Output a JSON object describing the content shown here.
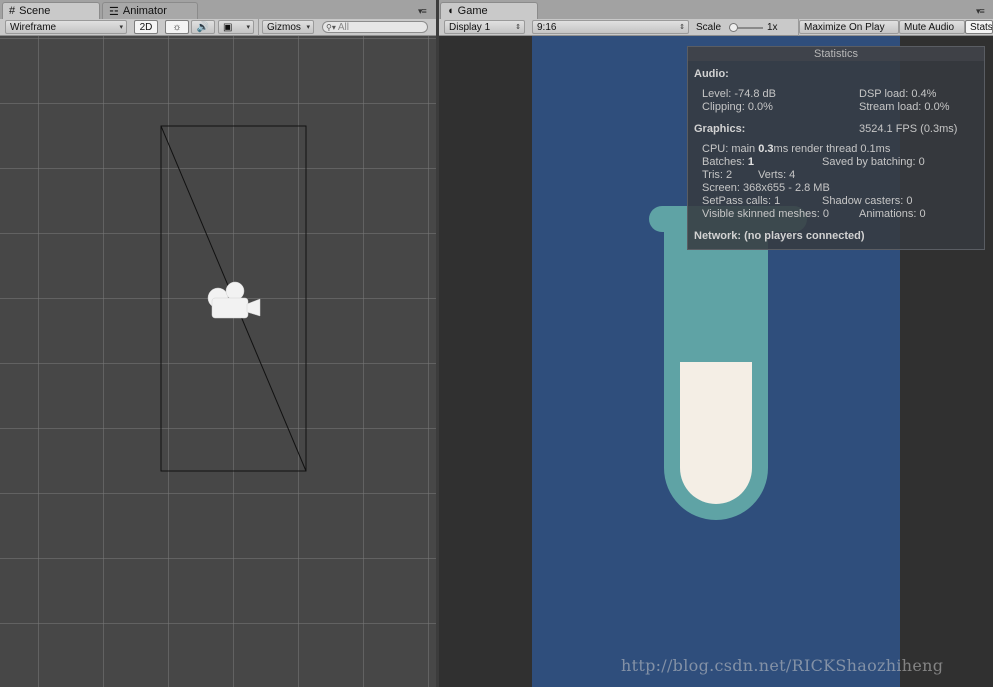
{
  "scene_panel": {
    "tabs": [
      {
        "label": "Scene",
        "icon": "grid-icon"
      },
      {
        "label": "Animator",
        "icon": "animator-icon"
      }
    ],
    "toolbar": {
      "shading_mode": "Wireframe",
      "mode_2d": "2D",
      "gizmos_label": "Gizmos",
      "search_placeholder": "All"
    }
  },
  "game_panel": {
    "tabs": [
      {
        "label": "Game",
        "icon": "pacman-icon"
      }
    ],
    "toolbar": {
      "display": "Display 1",
      "aspect": "9:16",
      "scale_label": "Scale",
      "scale_value": "1x",
      "maximize_label": "Maximize On Play",
      "mute_label": "Mute Audio",
      "stats_label": "Stats"
    },
    "colors": {
      "background": "#2f4e7c",
      "tube": "#5fa3a5",
      "liquid": "#f4eee5"
    }
  },
  "statistics": {
    "title": "Statistics",
    "audio_heading": "Audio:",
    "level": "Level: -74.8 dB",
    "dsp_load": "DSP load: 0.4%",
    "clipping": "Clipping: 0.0%",
    "stream_load": "Stream load: 0.0%",
    "graphics_heading": "Graphics:",
    "fps": "3524.1 FPS (0.3ms)",
    "cpu_prefix": "CPU: main ",
    "cpu_main": "0.3",
    "cpu_suffix": "ms  render thread 0.1ms",
    "batches_prefix": "Batches: ",
    "batches": "1",
    "saved_by_batching": "Saved by batching: 0",
    "tris": "Tris: 2",
    "verts": "Verts: 4",
    "screen": "Screen: 368x655 - 2.8 MB",
    "setpass": "SetPass calls: 1",
    "shadow_casters": "Shadow casters: 0",
    "skinned_meshes": "Visible skinned meshes: 0",
    "animations": "Animations: 0",
    "network": "Network: (no players connected)"
  },
  "watermark": "http://blog.csdn.net/RICKShaozhiheng"
}
